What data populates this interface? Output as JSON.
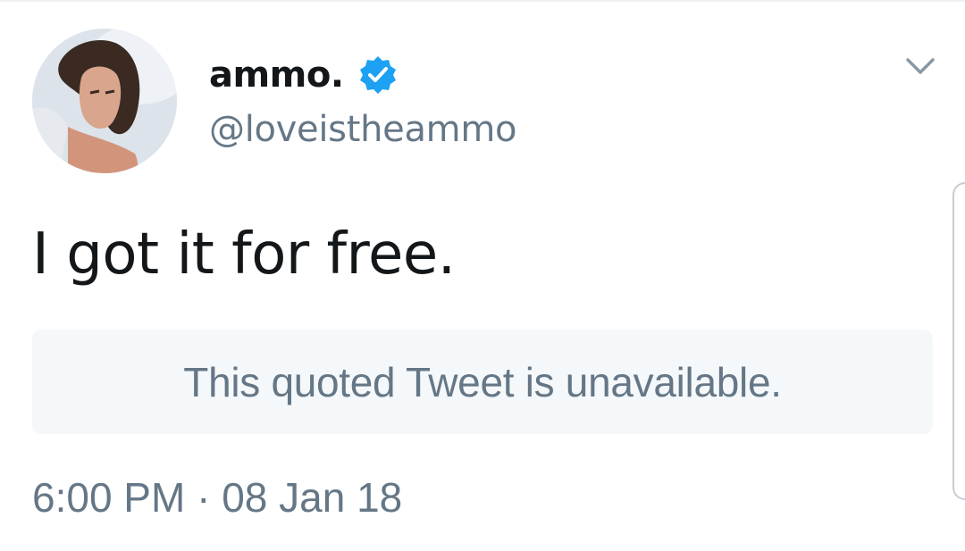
{
  "tweet": {
    "author": {
      "display_name": "ammo.",
      "handle": "@loveistheammo",
      "verified": true
    },
    "text": "I got it for free.",
    "quoted_tweet": {
      "text": "This quoted Tweet is unavailable."
    },
    "timestamp": {
      "time": "6:00 PM",
      "separator": "·",
      "date": "08 Jan 18"
    }
  },
  "icons": {
    "verified": "verified-badge-icon",
    "menu": "chevron-down-icon"
  },
  "colors": {
    "verified_blue": "#1da1f2",
    "secondary_text": "#657786",
    "primary_text": "#14171a",
    "quote_background": "#f5f8fa"
  }
}
